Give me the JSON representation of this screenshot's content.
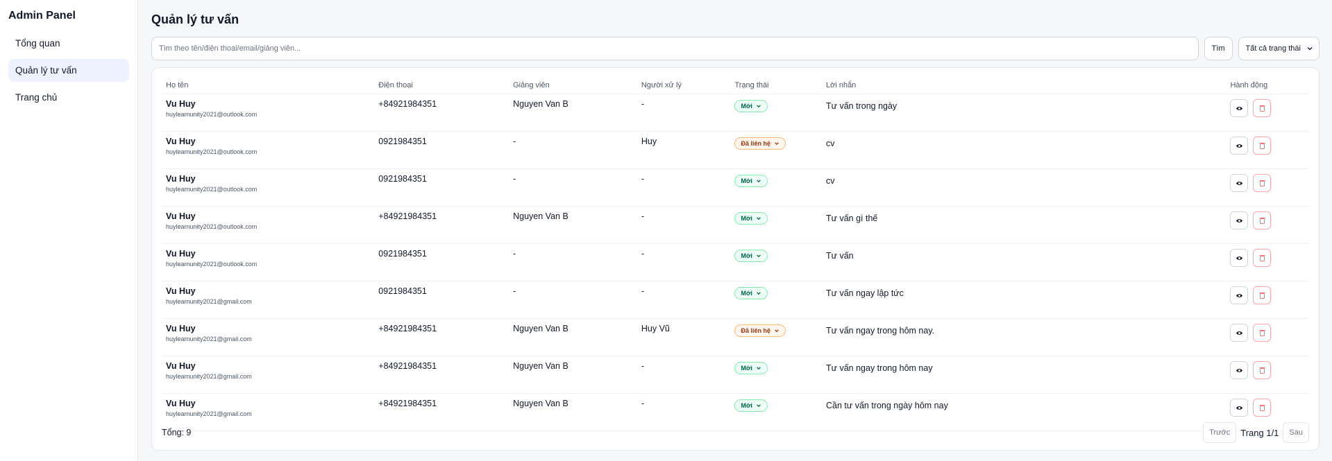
{
  "sidebar": {
    "brand": "Admin Panel",
    "items": [
      {
        "label": "Tổng quan"
      },
      {
        "label": "Quản lý tư vấn"
      },
      {
        "label": "Trang chủ"
      }
    ]
  },
  "header": {
    "title": "Quản lý tư vấn"
  },
  "toolbar": {
    "search_placeholder": "Tìm theo tên/điện thoại/email/giảng viên...",
    "search_button": "Tìm",
    "status_filter": "Tất cả trạng thái"
  },
  "table": {
    "columns": [
      "Họ tên",
      "Điện thoại",
      "Giảng viên",
      "Người xử lý",
      "Trạng thái",
      "Lời nhắn",
      "Hành động"
    ],
    "rows": [
      {
        "name": "Vu Huy",
        "email": "huylearnunity2021@outlook.com",
        "phone": "+84921984351",
        "lecturer": "Nguyen Van B",
        "handler": "-",
        "status": "Mới",
        "status_type": "new",
        "message": "Tư vấn trong ngày"
      },
      {
        "name": "Vu Huy",
        "email": "huylearnunity2021@outlook.com",
        "phone": "0921984351",
        "lecturer": "-",
        "handler": "Huy",
        "status": "Đã liên hệ",
        "status_type": "contacted",
        "message": "cv"
      },
      {
        "name": "Vu Huy",
        "email": "huylearnunity2021@outlook.com",
        "phone": "0921984351",
        "lecturer": "-",
        "handler": "-",
        "status": "Mới",
        "status_type": "new",
        "message": "cv"
      },
      {
        "name": "Vu Huy",
        "email": "huylearnunity2021@outlook.com",
        "phone": "+84921984351",
        "lecturer": "Nguyen Van B",
        "handler": "-",
        "status": "Mới",
        "status_type": "new",
        "message": "Tư vấn gì thế"
      },
      {
        "name": "Vu Huy",
        "email": "huylearnunity2021@outlook.com",
        "phone": "0921984351",
        "lecturer": "-",
        "handler": "-",
        "status": "Mới",
        "status_type": "new",
        "message": "Tư vấn"
      },
      {
        "name": "Vu Huy",
        "email": "huylearnunity2021@gmail.com",
        "phone": "0921984351",
        "lecturer": "-",
        "handler": "-",
        "status": "Mới",
        "status_type": "new",
        "message": "Tư vấn ngay lập tức"
      },
      {
        "name": "Vu Huy",
        "email": "huylearnunity2021@gmail.com",
        "phone": "+84921984351",
        "lecturer": "Nguyen Van B",
        "handler": "Huy Vũ",
        "status": "Đã liên hệ",
        "status_type": "contacted",
        "message": "Tư vấn ngay trong hôm nay."
      },
      {
        "name": "Vu Huy",
        "email": "huylearnunity2021@gmail.com",
        "phone": "+84921984351",
        "lecturer": "Nguyen Van B",
        "handler": "-",
        "status": "Mới",
        "status_type": "new",
        "message": "Tư vấn ngay trong hôm nay"
      },
      {
        "name": "Vu Huy",
        "email": "huylearnunity2021@gmail.com",
        "phone": "+84921984351",
        "lecturer": "Nguyen Van B",
        "handler": "-",
        "status": "Mới",
        "status_type": "new",
        "message": "Cần tư vấn trong ngày hôm nay"
      }
    ]
  },
  "footer": {
    "total": "Tổng: 9",
    "prev": "Trước",
    "page_info": "Trang 1/1",
    "next": "Sau"
  },
  "icons": {
    "view": "eye-icon",
    "delete": "trash-icon",
    "dropdown": "chevron-down-icon"
  },
  "colors": {
    "status_new_bg": "#ecfdf5",
    "status_new_border": "#86efac",
    "status_contacted_bg": "#fff7ed",
    "status_contacted_border": "#fdba74",
    "active_nav": "#eef2ff"
  }
}
